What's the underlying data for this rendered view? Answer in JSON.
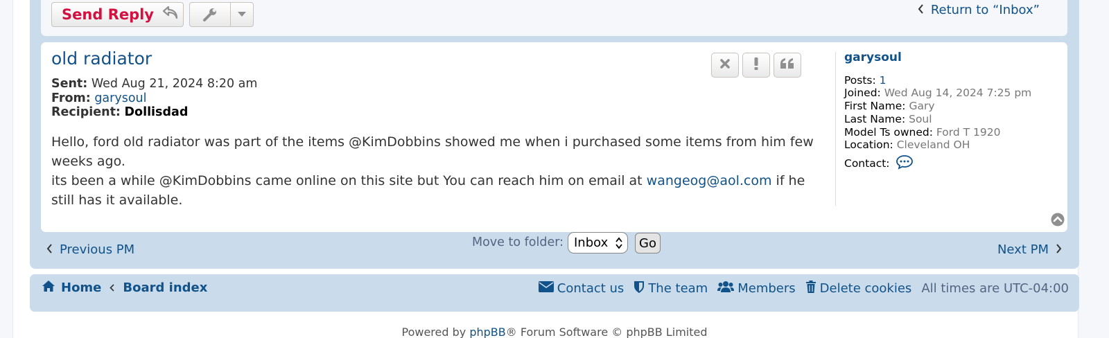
{
  "toolbar": {
    "send_reply_label": "Send Reply",
    "return_label": "Return to “Inbox”"
  },
  "message": {
    "title": "old radiator",
    "sent_label": "Sent:",
    "sent_value": "Wed Aug 21, 2024 8:20 am",
    "from_label": "From:",
    "from_value": "garysoul",
    "recipient_label": "Recipient:",
    "recipient_value": "Dollisdad",
    "body_line1": "Hello, ford old radiator was part of the items @KimDobbins showed me when i purchased some items from him few weeks ago.",
    "body_line2_pre": "its been a while @KimDobbins came online on this site but You can reach him on email at ",
    "body_email": "wangeog@aol.com",
    "body_line2_post": " if he still has it available."
  },
  "profile": {
    "username": "garysoul",
    "posts_label": "Posts:",
    "posts_value": "1",
    "joined_label": "Joined:",
    "joined_value": "Wed Aug 14, 2024 7:25 pm",
    "first_name_label": "First Name:",
    "first_name_value": "Gary",
    "last_name_label": "Last Name:",
    "last_name_value": "Soul",
    "model_label": "Model Ts owned:",
    "model_value": "Ford T 1920",
    "location_label": "Location:",
    "location_value": "Cleveland OH",
    "contact_label": "Contact:"
  },
  "nav": {
    "prev_label": "Previous PM",
    "next_label": "Next PM",
    "move_label": "Move to folder:",
    "folder_selected": "Inbox",
    "go_label": "Go"
  },
  "footer": {
    "home_label": "Home",
    "board_index_label": "Board index",
    "contact_label": "Contact us",
    "team_label": "The team",
    "members_label": "Members",
    "delete_cookies_label": "Delete cookies",
    "timezone_text": "All times are UTC-04:00",
    "powered_pre": "Powered by ",
    "powered_link": "phpBB",
    "powered_post": "® Forum Software © phpBB Limited"
  },
  "colors": {
    "link": "#105289",
    "reply": "#d31141",
    "panel_bg": "#cadceb"
  }
}
